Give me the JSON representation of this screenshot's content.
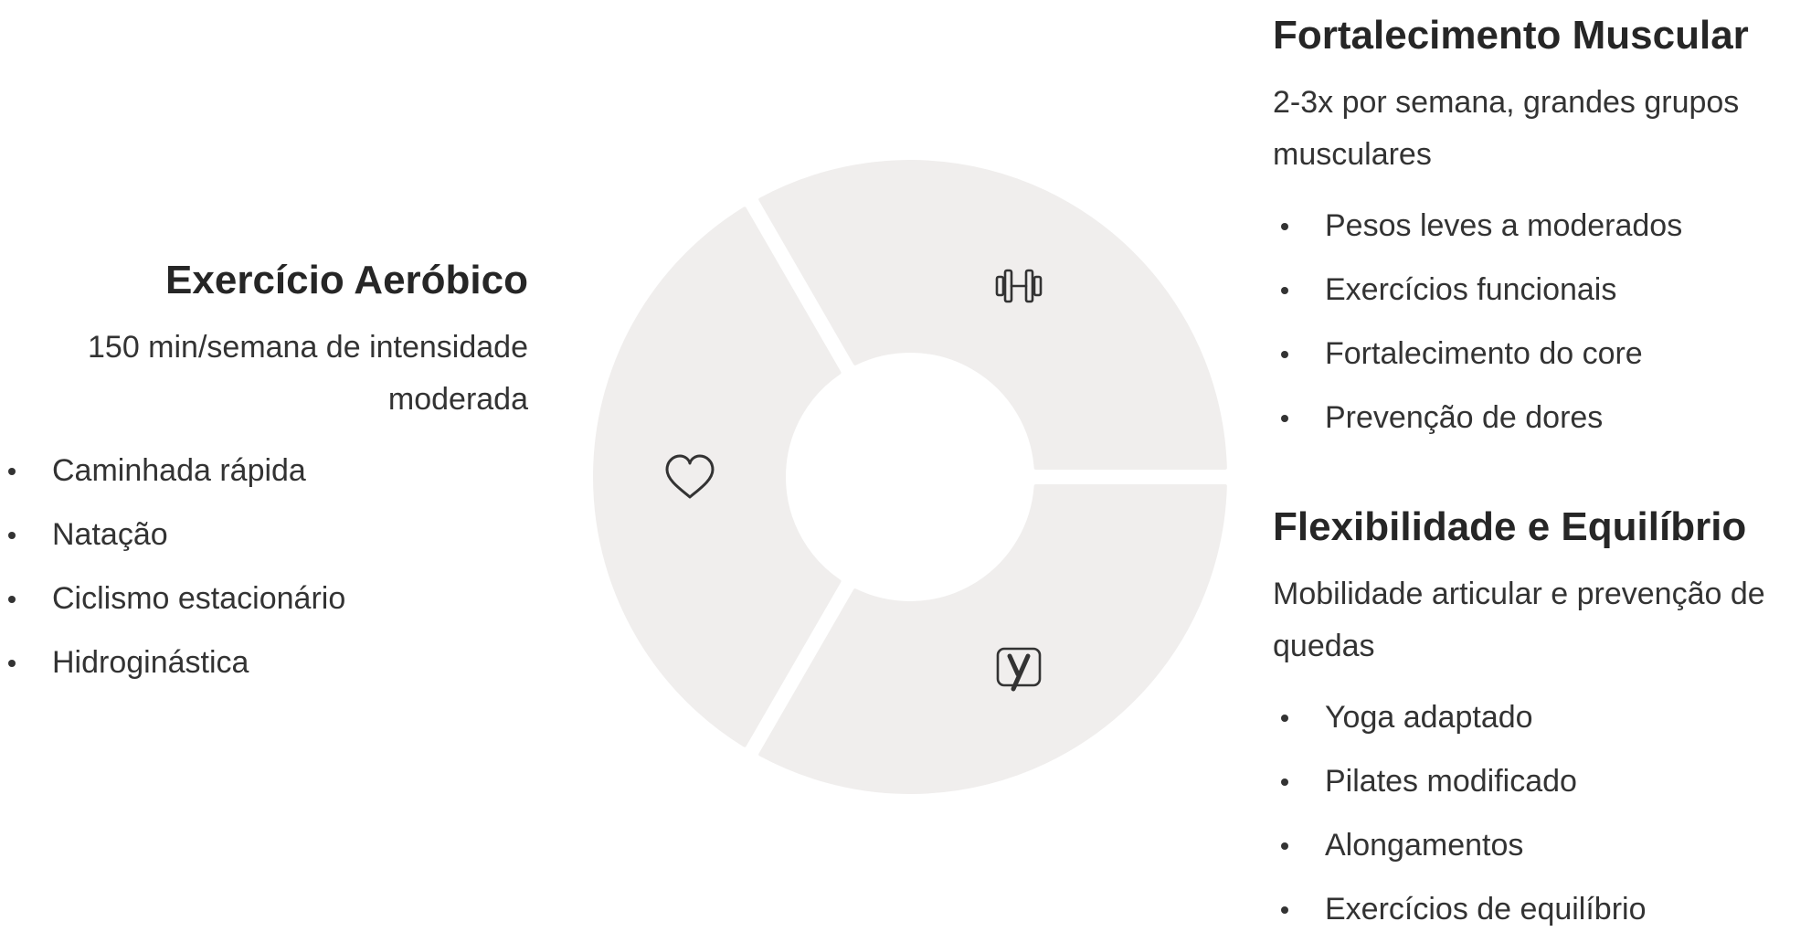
{
  "segments": [
    {
      "title": "Exercício Aeróbico",
      "description": "150 min/semana de intensidade moderada",
      "icon": "heart-icon",
      "items": [
        "Caminhada rápida",
        "Natação",
        "Ciclismo estacionário",
        "Hidroginástica"
      ]
    },
    {
      "title": "Fortalecimento Muscular",
      "description": "2-3x por semana, grandes grupos musculares",
      "icon": "dumbbell-icon",
      "items": [
        "Pesos leves a moderados",
        "Exercícios funcionais",
        "Fortalecimento do core",
        "Prevenção de dores"
      ]
    },
    {
      "title": "Flexibilidade e Equilíbrio",
      "description": "Mobilidade articular e prevenção de quedas",
      "icon": "yoga-icon",
      "items": [
        "Yoga adaptado",
        "Pilates modificado",
        "Alongamentos",
        "Exercícios de equilíbrio"
      ]
    }
  ],
  "colors": {
    "segment_fill": "#f0eeed",
    "icon_stroke": "#333333",
    "text": "#262626"
  }
}
